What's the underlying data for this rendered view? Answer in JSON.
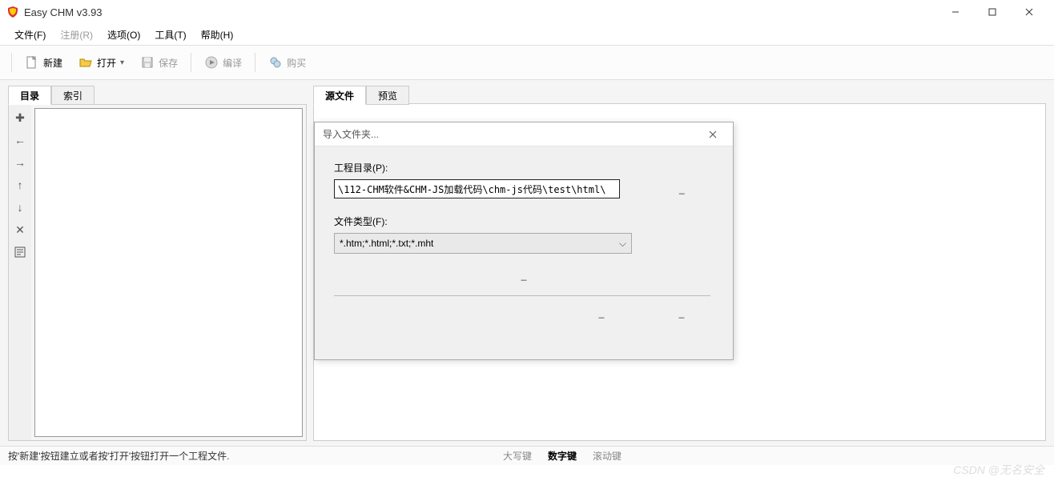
{
  "titlebar": {
    "title": "Easy CHM v3.93"
  },
  "menu": {
    "file": "文件(F)",
    "register": "注册(R)",
    "options": "选项(O)",
    "tools": "工具(T)",
    "help": "帮助(H)"
  },
  "toolbar": {
    "new": "新建",
    "open": "打开",
    "save": "保存",
    "compile": "编译",
    "buy": "购买"
  },
  "left_tabs": {
    "toc": "目录",
    "index": "索引"
  },
  "right_tabs": {
    "source": "源文件",
    "preview": "预览"
  },
  "dialog": {
    "title": "导入文件夹...",
    "project_dir_label": "工程目录(P):",
    "project_dir_value": "\\112-CHM软件&CHM-JS加载代码\\chm-js代码\\test\\html\\",
    "browse": "_",
    "filetype_label": "文件类型(F):",
    "filetype_value": "*.htm;*.html;*.txt;*.mht",
    "include_subdir": "_",
    "ok": "_",
    "cancel": "_"
  },
  "status": {
    "hint": "按'新建'按钮建立或者按'打开'按钮打开一个工程文件.",
    "caps": "大写键",
    "num": "数字键",
    "scroll": "滚动键"
  },
  "watermark": "CSDN @无名安全"
}
